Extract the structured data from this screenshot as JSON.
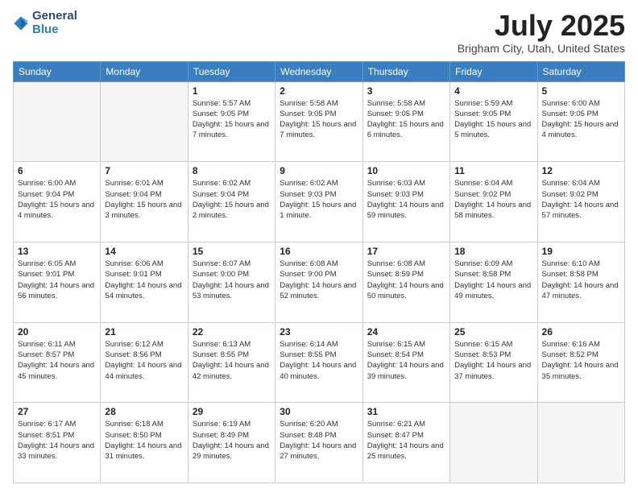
{
  "header": {
    "logo": {
      "line1": "General",
      "line2": "Blue"
    },
    "month": "July 2025",
    "location": "Brigham City, Utah, United States"
  },
  "weekdays": [
    "Sunday",
    "Monday",
    "Tuesday",
    "Wednesday",
    "Thursday",
    "Friday",
    "Saturday"
  ],
  "weeks": [
    [
      {
        "day": "",
        "info": ""
      },
      {
        "day": "",
        "info": ""
      },
      {
        "day": "1",
        "info": "Sunrise: 5:57 AM\nSunset: 9:05 PM\nDaylight: 15 hours and 7 minutes."
      },
      {
        "day": "2",
        "info": "Sunrise: 5:58 AM\nSunset: 9:05 PM\nDaylight: 15 hours and 7 minutes."
      },
      {
        "day": "3",
        "info": "Sunrise: 5:58 AM\nSunset: 9:05 PM\nDaylight: 15 hours and 6 minutes."
      },
      {
        "day": "4",
        "info": "Sunrise: 5:59 AM\nSunset: 9:05 PM\nDaylight: 15 hours and 5 minutes."
      },
      {
        "day": "5",
        "info": "Sunrise: 6:00 AM\nSunset: 9:05 PM\nDaylight: 15 hours and 4 minutes."
      }
    ],
    [
      {
        "day": "6",
        "info": "Sunrise: 6:00 AM\nSunset: 9:04 PM\nDaylight: 15 hours and 4 minutes."
      },
      {
        "day": "7",
        "info": "Sunrise: 6:01 AM\nSunset: 9:04 PM\nDaylight: 15 hours and 3 minutes."
      },
      {
        "day": "8",
        "info": "Sunrise: 6:02 AM\nSunset: 9:04 PM\nDaylight: 15 hours and 2 minutes."
      },
      {
        "day": "9",
        "info": "Sunrise: 6:02 AM\nSunset: 9:03 PM\nDaylight: 15 hours and 1 minute."
      },
      {
        "day": "10",
        "info": "Sunrise: 6:03 AM\nSunset: 9:03 PM\nDaylight: 14 hours and 59 minutes."
      },
      {
        "day": "11",
        "info": "Sunrise: 6:04 AM\nSunset: 9:02 PM\nDaylight: 14 hours and 58 minutes."
      },
      {
        "day": "12",
        "info": "Sunrise: 6:04 AM\nSunset: 9:02 PM\nDaylight: 14 hours and 57 minutes."
      }
    ],
    [
      {
        "day": "13",
        "info": "Sunrise: 6:05 AM\nSunset: 9:01 PM\nDaylight: 14 hours and 56 minutes."
      },
      {
        "day": "14",
        "info": "Sunrise: 6:06 AM\nSunset: 9:01 PM\nDaylight: 14 hours and 54 minutes."
      },
      {
        "day": "15",
        "info": "Sunrise: 6:07 AM\nSunset: 9:00 PM\nDaylight: 14 hours and 53 minutes."
      },
      {
        "day": "16",
        "info": "Sunrise: 6:08 AM\nSunset: 9:00 PM\nDaylight: 14 hours and 52 minutes."
      },
      {
        "day": "17",
        "info": "Sunrise: 6:08 AM\nSunset: 8:59 PM\nDaylight: 14 hours and 50 minutes."
      },
      {
        "day": "18",
        "info": "Sunrise: 6:09 AM\nSunset: 8:58 PM\nDaylight: 14 hours and 49 minutes."
      },
      {
        "day": "19",
        "info": "Sunrise: 6:10 AM\nSunset: 8:58 PM\nDaylight: 14 hours and 47 minutes."
      }
    ],
    [
      {
        "day": "20",
        "info": "Sunrise: 6:11 AM\nSunset: 8:57 PM\nDaylight: 14 hours and 45 minutes."
      },
      {
        "day": "21",
        "info": "Sunrise: 6:12 AM\nSunset: 8:56 PM\nDaylight: 14 hours and 44 minutes."
      },
      {
        "day": "22",
        "info": "Sunrise: 6:13 AM\nSunset: 8:55 PM\nDaylight: 14 hours and 42 minutes."
      },
      {
        "day": "23",
        "info": "Sunrise: 6:14 AM\nSunset: 8:55 PM\nDaylight: 14 hours and 40 minutes."
      },
      {
        "day": "24",
        "info": "Sunrise: 6:15 AM\nSunset: 8:54 PM\nDaylight: 14 hours and 39 minutes."
      },
      {
        "day": "25",
        "info": "Sunrise: 6:15 AM\nSunset: 8:53 PM\nDaylight: 14 hours and 37 minutes."
      },
      {
        "day": "26",
        "info": "Sunrise: 6:16 AM\nSunset: 8:52 PM\nDaylight: 14 hours and 35 minutes."
      }
    ],
    [
      {
        "day": "27",
        "info": "Sunrise: 6:17 AM\nSunset: 8:51 PM\nDaylight: 14 hours and 33 minutes."
      },
      {
        "day": "28",
        "info": "Sunrise: 6:18 AM\nSunset: 8:50 PM\nDaylight: 14 hours and 31 minutes."
      },
      {
        "day": "29",
        "info": "Sunrise: 6:19 AM\nSunset: 8:49 PM\nDaylight: 14 hours and 29 minutes."
      },
      {
        "day": "30",
        "info": "Sunrise: 6:20 AM\nSunset: 8:48 PM\nDaylight: 14 hours and 27 minutes."
      },
      {
        "day": "31",
        "info": "Sunrise: 6:21 AM\nSunset: 8:47 PM\nDaylight: 14 hours and 25 minutes."
      },
      {
        "day": "",
        "info": ""
      },
      {
        "day": "",
        "info": ""
      }
    ]
  ]
}
